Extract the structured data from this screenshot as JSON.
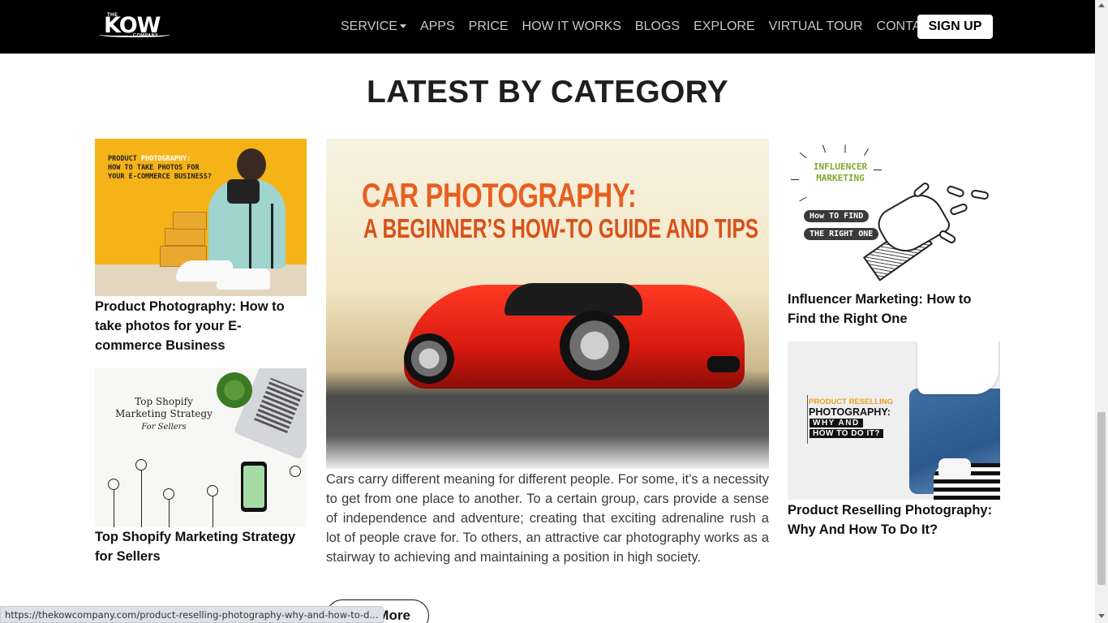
{
  "header": {
    "logo": {
      "the": "THE",
      "kow": "KOW",
      "company": "COMPANY"
    },
    "nav": [
      {
        "label": "SERVICE",
        "has_dropdown": true
      },
      {
        "label": "APPS"
      },
      {
        "label": "PRICE"
      },
      {
        "label": "HOW IT WORKS"
      },
      {
        "label": "BLOGS"
      },
      {
        "label": "EXPLORE"
      },
      {
        "label": "VIRTUAL TOUR"
      },
      {
        "label": "CONTACT"
      }
    ],
    "signup_label": "SIGN UP"
  },
  "section": {
    "heading": "LATEST BY CATEGORY"
  },
  "left_cards": [
    {
      "title": "Product Photography: How to take photos for your E-commerce Business",
      "image_text": {
        "line1a": "PRODUCT ",
        "line1b": "PHOTOGRAPHY:",
        "line2": "HOW TO TAKE PHOTOS FOR",
        "line3": "YOUR E-COMMERCE BUSINESS?"
      }
    },
    {
      "title": "Top Shopify Marketing Strategy for Sellers",
      "image_text": {
        "line1": "Top Shopify",
        "line2": "Marketing Strategy",
        "line3": "For Sellers"
      }
    }
  ],
  "featured": {
    "image_text": {
      "line1": "CAR PHOTOGRAPHY:",
      "line2": "A BEGINNER’S HOW-TO GUIDE AND TIPS"
    },
    "excerpt": "Cars carry different meaning for different people. For some, it’s a necessity to get from one place to another. To a certain group, cars provide a sense of independence and adventure; creating that exciting adrenaline rush a lot of people crave for. To others, an attractive car photography works as a stairway to achieving and maintaining a position in high society.",
    "read_more_label": "Read More"
  },
  "right_cards": [
    {
      "title": "Influencer Marketing: How to Find the Right One",
      "image_text": {
        "line1": "INFLUENCER",
        "line2": "MARKETING",
        "pill1": "How TO FIND",
        "pill2": "THE RIGHT ONE"
      }
    },
    {
      "title": "Product Reselling Photography: Why And How To Do It?",
      "image_text": {
        "line1": "PRODUCT RESELLING",
        "line2": "PHOTOGRAPHY:",
        "line3": "WHY AND",
        "line4": "HOW TO DO IT?"
      }
    }
  ],
  "status_bar": {
    "url": "https://thekowcompany.com/product-reselling-photography-why-and-how-to-d..."
  },
  "colors": {
    "nav_bg": "#000000",
    "nav_text": "#c7c7c7",
    "heading": "#1e1e1e",
    "accent_orange": "#e85f1f",
    "influencer_green": "#7bab2c"
  }
}
